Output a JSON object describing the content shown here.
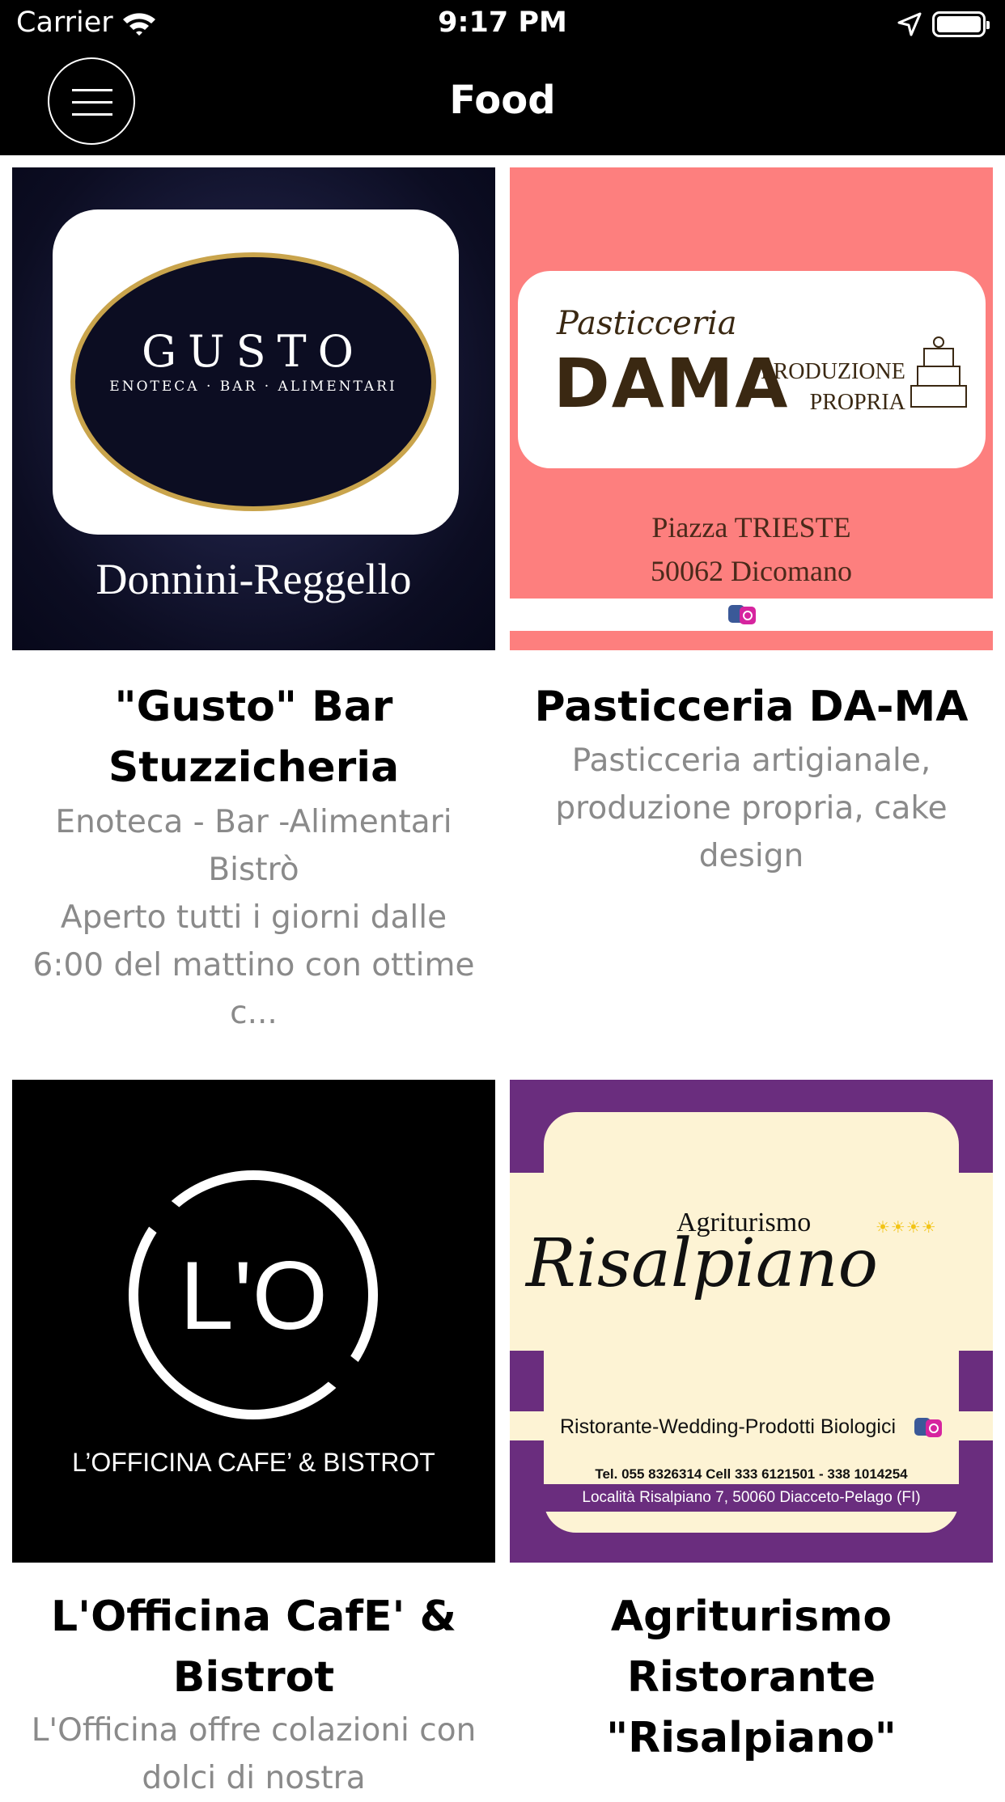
{
  "status_bar": {
    "carrier": "Carrier",
    "time": "9:17 PM"
  },
  "nav": {
    "title": "Food"
  },
  "cards": [
    {
      "title": "\"Gusto\" Bar Stuzzicheria",
      "description": "Enoteca - Bar -Alimentari\nBistrò\nAperto tutti i giorni dalle 6:00  del mattino con ottime c...",
      "image": {
        "logo_text": "GUSTO",
        "logo_sub": "ENOTECA · BAR · ALIMENTARI",
        "caption": "Donnini-Reggello",
        "background": "#0c0d22",
        "accent": "#c9a44c"
      }
    },
    {
      "title": "Pasticceria DA-MA",
      "description": "Pasticceria artigianale, produzione propria, cake design",
      "image": {
        "script": "Pasticceria",
        "big": "DAMA",
        "tagline": "PRODUZIONE\nPROPRIA",
        "address_1": "Piazza TRIESTE",
        "address_2": "50062 Dicomano",
        "background": "#fd7f7e"
      }
    },
    {
      "title": "L'Officina CafE' & Bistrot",
      "description": "L'Officina offre colazioni con dolci di nostra",
      "image": {
        "monogram": "L'O",
        "name": "L’OFFICINA CAFE’ & BISTROT",
        "background": "#000000"
      }
    },
    {
      "title": "Agriturismo Ristorante \"Risalpiano\"",
      "description": "",
      "image": {
        "agri": "Agriturismo",
        "suns": "☀☀☀☀",
        "script": "Risalpiano",
        "subtitle": "Ristorante-Wedding-Prodotti Biologici",
        "tel": "Tel. 055 8326314 Cell 333 6121501 - 338 1014254",
        "address": "Località Risalpiano 7, 50060 Diacceto-Pelago (FI)",
        "background": "#6a2d7e",
        "panel": "#fdf3d4"
      }
    }
  ]
}
